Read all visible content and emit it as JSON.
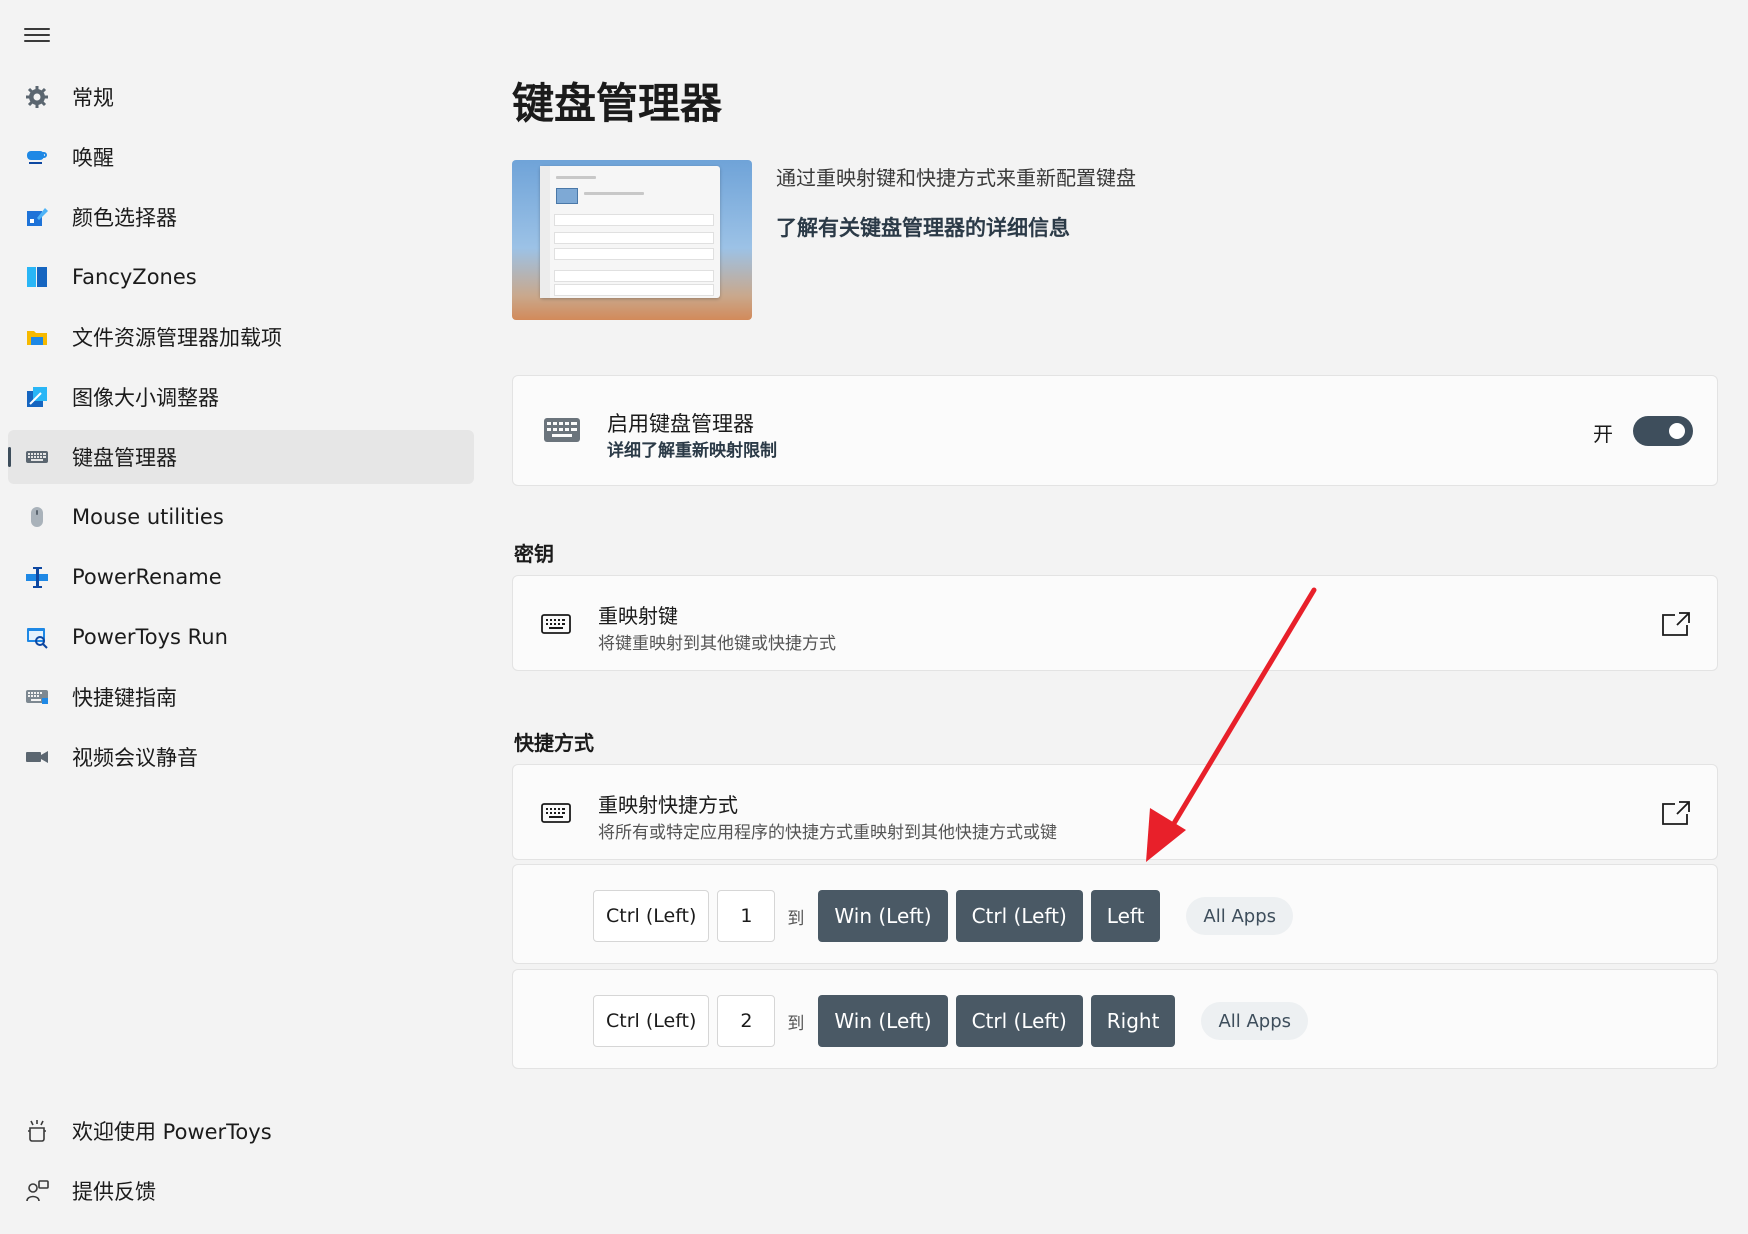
{
  "sidebar": {
    "items": [
      {
        "label": "常规",
        "icon": "gear-icon"
      },
      {
        "label": "唤醒",
        "icon": "coffee-cup-icon"
      },
      {
        "label": "颜色选择器",
        "icon": "color-picker-icon"
      },
      {
        "label": "FancyZones",
        "icon": "fancyzones-icon"
      },
      {
        "label": "文件资源管理器加载项",
        "icon": "folder-icon"
      },
      {
        "label": "图像大小调整器",
        "icon": "image-resizer-icon"
      },
      {
        "label": "键盘管理器",
        "icon": "keyboard-icon"
      },
      {
        "label": "Mouse utilities",
        "icon": "mouse-icon"
      },
      {
        "label": "PowerRename",
        "icon": "rename-icon"
      },
      {
        "label": "PowerToys Run",
        "icon": "run-icon"
      },
      {
        "label": "快捷键指南",
        "icon": "shortcut-guide-icon"
      },
      {
        "label": "视频会议静音",
        "icon": "camera-icon"
      }
    ],
    "active_index": 6,
    "bottom": [
      {
        "label": "欢迎使用 PowerToys",
        "icon": "welcome-icon"
      },
      {
        "label": "提供反馈",
        "icon": "feedback-icon"
      }
    ]
  },
  "page": {
    "title": "键盘管理器",
    "description": "通过重映射键和快捷方式来重新配置键盘",
    "learn_more": "了解有关键盘管理器的详细信息"
  },
  "enable_card": {
    "title": "启用键盘管理器",
    "link": "详细了解重新映射限制",
    "toggle_label": "开",
    "toggle_on": true
  },
  "keys_section": {
    "header": "密钥",
    "title": "重映射键",
    "subtitle": "将键重映射到其他键或快捷方式"
  },
  "shortcuts_section": {
    "header": "快捷方式",
    "title": "重映射快捷方式",
    "subtitle": "将所有或特定应用程序的快捷方式重映射到其他快捷方式或键",
    "mappings": [
      {
        "from": [
          "Ctrl (Left)",
          "1"
        ],
        "to_word": "到",
        "to": [
          "Win (Left)",
          "Ctrl (Left)",
          "Left"
        ],
        "app": "All Apps"
      },
      {
        "from": [
          "Ctrl (Left)",
          "2"
        ],
        "to_word": "到",
        "to": [
          "Win (Left)",
          "Ctrl (Left)",
          "Right"
        ],
        "app": "All Apps"
      }
    ]
  },
  "colors": {
    "accent": "#3e4e5c",
    "key_dark": "#4a5965",
    "annotation_arrow": "#e8202a"
  }
}
